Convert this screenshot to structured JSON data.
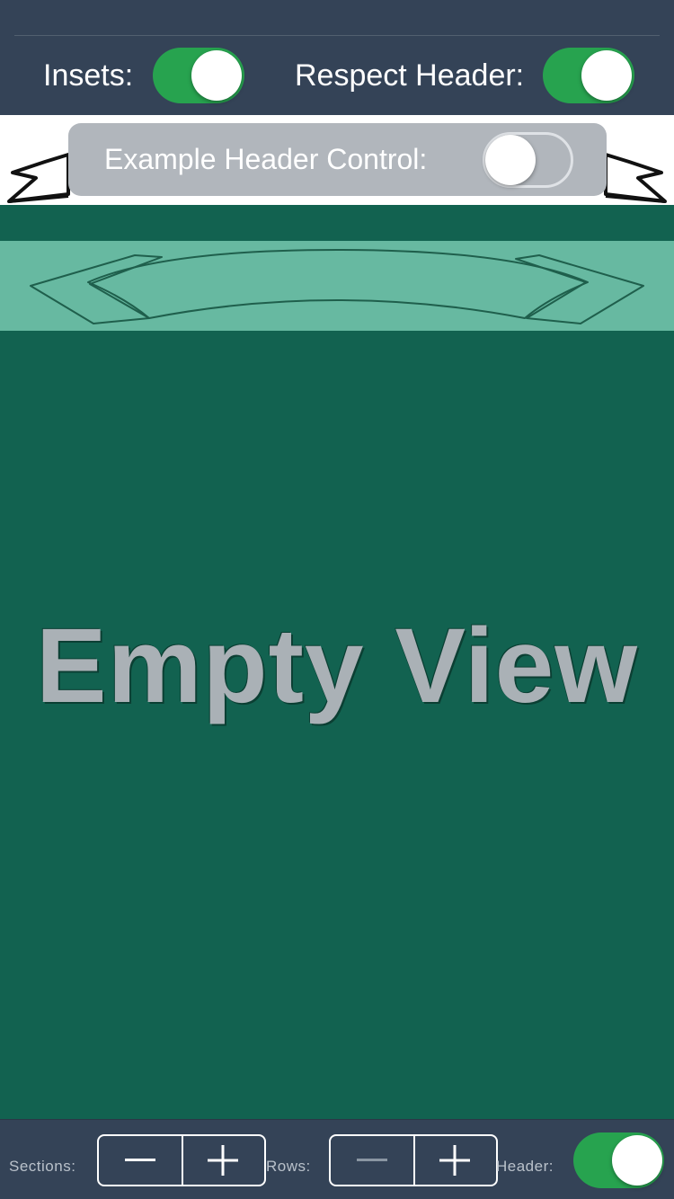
{
  "top_bar": {
    "insets_label": "Insets:",
    "insets_on": true,
    "respect_header_label": "Respect Header:",
    "respect_header_on": true
  },
  "header": {
    "control_label": "Example Header Control:",
    "control_on": false
  },
  "content": {
    "empty_title": "Empty View"
  },
  "bottom_bar": {
    "sections_label": "Sections:",
    "rows_label": "Rows:",
    "header_label": "Header:",
    "header_on": true,
    "sections_minus_icon": "minus-icon",
    "sections_plus_icon": "plus-icon",
    "rows_minus_icon": "minus-icon",
    "rows_plus_icon": "plus-icon"
  },
  "colors": {
    "toolbar_bg": "#344357",
    "switch_on": "#27a34f",
    "content_bg": "#126250",
    "banner_bg": "#67b9a1",
    "header_panel": "#b1b6bc",
    "empty_text": "#aab1b6"
  }
}
